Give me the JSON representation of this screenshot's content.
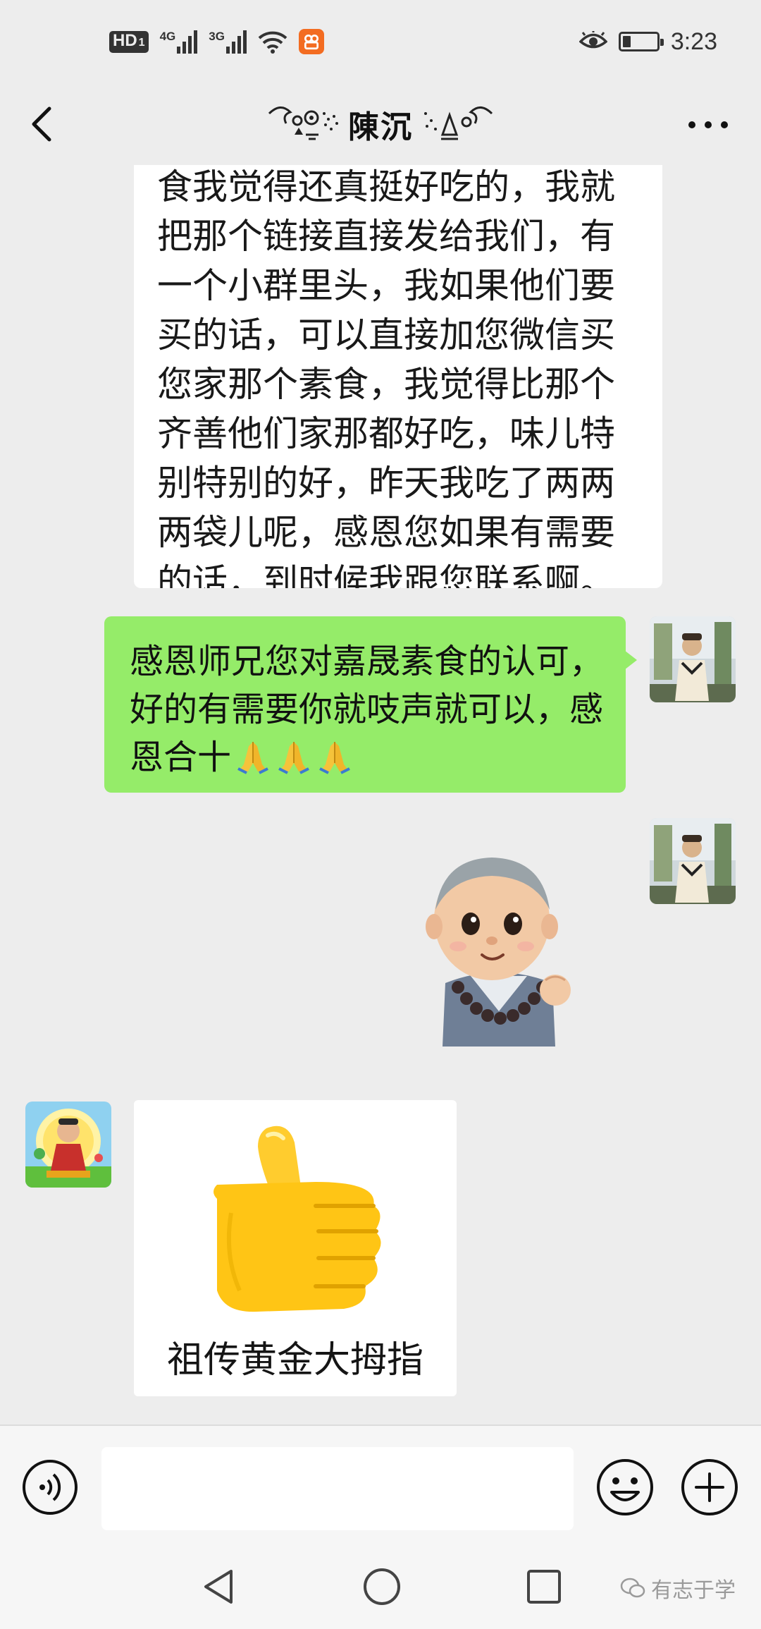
{
  "status_bar": {
    "hd_label": "HD",
    "hd_sub": "1",
    "net1_label": "4G",
    "net2_label": "3G",
    "time": "3:23",
    "battery_level": 0.24
  },
  "nav": {
    "title": "陳沉"
  },
  "messages": {
    "incoming_text": "食我觉得还真挺好吃的，我就把那个链接直接发给我们，有一个小群里头，我如果他们要买的话，可以直接加您微信买您家那个素食，我觉得比那个齐善他们家那都好吃，味儿特别特别的好，昨天我吃了两两两袋儿呢，感恩您如果有需要的话，到时候我跟您联系啊。",
    "outgoing_text": "感恩师兄您对嘉晟素食的认可，好的有需要你就吱声就可以，感恩合十",
    "sticker_caption": "祖传黄金大拇指"
  },
  "input": {
    "value": "",
    "placeholder": ""
  },
  "watermark": {
    "text": "有志于学"
  },
  "colors": {
    "chat_background": "#ededed",
    "outgoing_bubble": "#95ec69",
    "incoming_bubble": "#ffffff",
    "status_badge_app": "#f36c21"
  },
  "icons": {
    "back": "chevron-left-icon",
    "more": "more-horizontal-icon",
    "voice": "voice-icon",
    "emoji": "smile-icon",
    "plus": "plus-circle-icon",
    "pray": "folded-hands-emoji",
    "thumbs_up": "thumbs-up-emoji"
  }
}
